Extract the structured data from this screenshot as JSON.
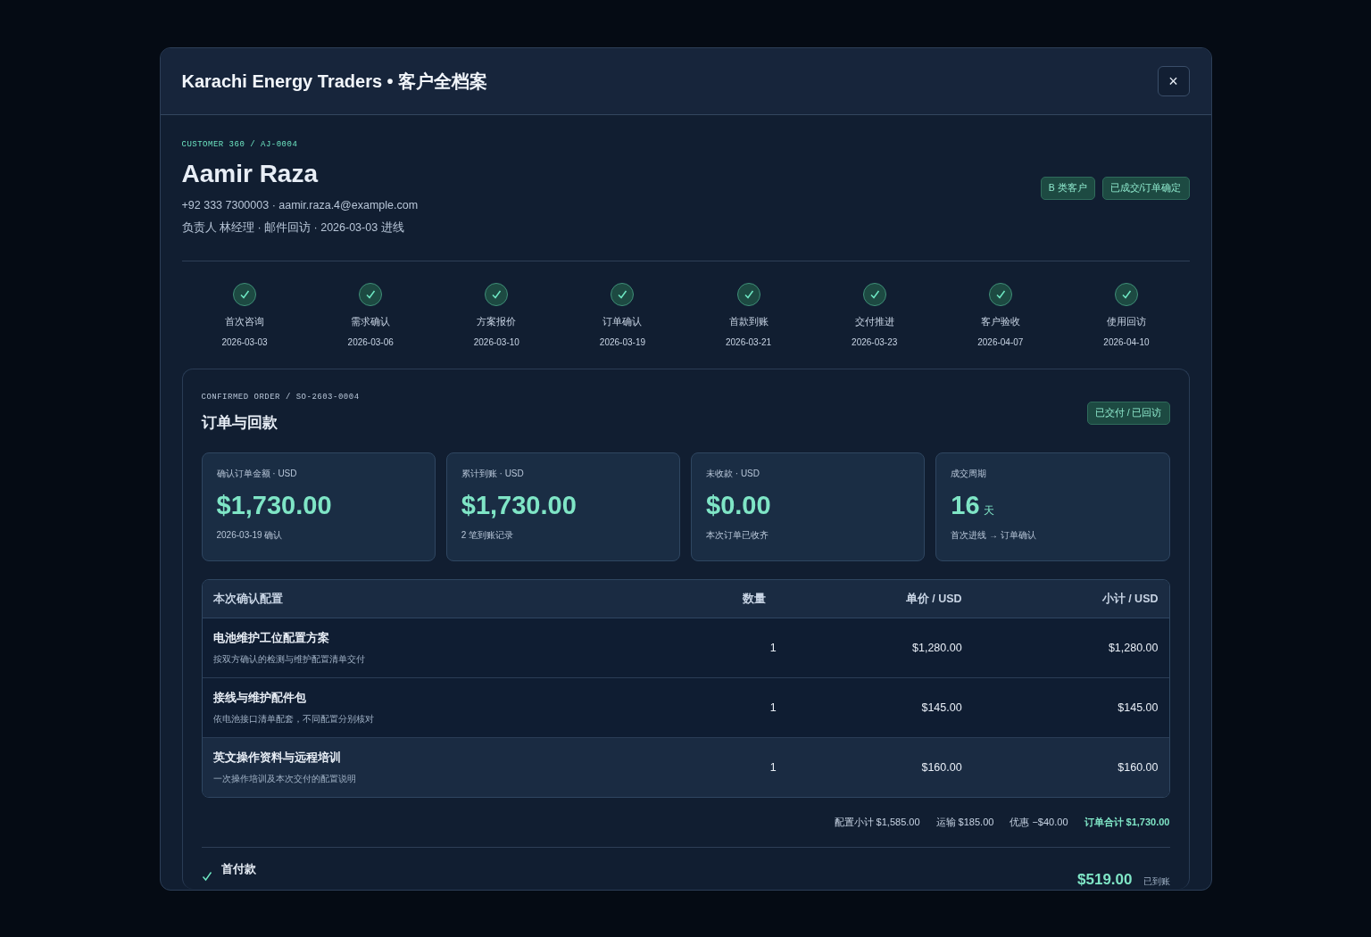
{
  "modal": {
    "title": "Karachi Energy Traders • 客户全档案",
    "close": "×"
  },
  "customer": {
    "eyebrow": "CUSTOMER 360 / AJ-0004",
    "name": "Aamir Raza",
    "contact": "+92 333 7300003 · aamir.raza.4@example.com",
    "meta": "负责人 林经理 · 邮件回访 · 2026-03-03 进线",
    "tags": [
      "B 类客户",
      "已成交/订单确定"
    ]
  },
  "steps": [
    {
      "label": "首次咨询",
      "date": "2026-03-03",
      "done": true
    },
    {
      "label": "需求确认",
      "date": "2026-03-06",
      "done": true
    },
    {
      "label": "方案报价",
      "date": "2026-03-10",
      "done": true
    },
    {
      "label": "订单确认",
      "date": "2026-03-19",
      "done": true
    },
    {
      "label": "首款到账",
      "date": "2026-03-21",
      "done": true
    },
    {
      "label": "交付推进",
      "date": "2026-03-23",
      "done": true
    },
    {
      "label": "客户验收",
      "date": "2026-04-07",
      "done": true
    },
    {
      "label": "使用回访",
      "date": "2026-04-10",
      "done": true
    }
  ],
  "order": {
    "eyebrow": "CONFIRMED ORDER / SO-2603-0004",
    "title": "订单与回款",
    "status": "已交付 / 已回访",
    "stats": [
      {
        "label": "确认订单金额 · USD",
        "value": "$1,730.00",
        "note": "2026-03-19 确认"
      },
      {
        "label": "累计到账 · USD",
        "value": "$1,730.00",
        "note": "2 笔到账记录"
      },
      {
        "label": "未收款 · USD",
        "value": "$0.00",
        "note": "本次订单已收齐"
      },
      {
        "label": "成交周期",
        "value": "16",
        "unit": "天",
        "note": "首次进线 → 订单确认"
      }
    ],
    "table": {
      "columns": [
        "本次确认配置",
        "数量",
        "单价 / USD",
        "小计 / USD"
      ],
      "rows": [
        {
          "name": "电池维护工位配置方案",
          "desc": "按双方确认的检测与维护配置清单交付",
          "qty": "1",
          "price": "$1,280.00",
          "subtotal": "$1,280.00",
          "highlighted": false
        },
        {
          "name": "接线与维护配件包",
          "desc": "依电池接口清单配套，不同配置分别核对",
          "qty": "1",
          "price": "$145.00",
          "subtotal": "$145.00",
          "highlighted": false
        },
        {
          "name": "英文操作资料与远程培训",
          "desc": "一次操作培训及本次交付的配置说明",
          "qty": "1",
          "price": "$160.00",
          "subtotal": "$160.00",
          "highlighted": true
        }
      ]
    },
    "totals": [
      {
        "text": "配置小计 $1,585.00",
        "kind": "plain"
      },
      {
        "text": "运输 $185.00",
        "kind": "plain"
      },
      {
        "text": "优惠 −$40.00",
        "kind": "plain"
      },
      {
        "text": "订单合计 $1,730.00",
        "kind": "total"
      }
    ],
    "payments": [
      {
        "title": "首付款",
        "amount": "$519.00",
        "status": "已到账",
        "received": true
      }
    ]
  }
}
